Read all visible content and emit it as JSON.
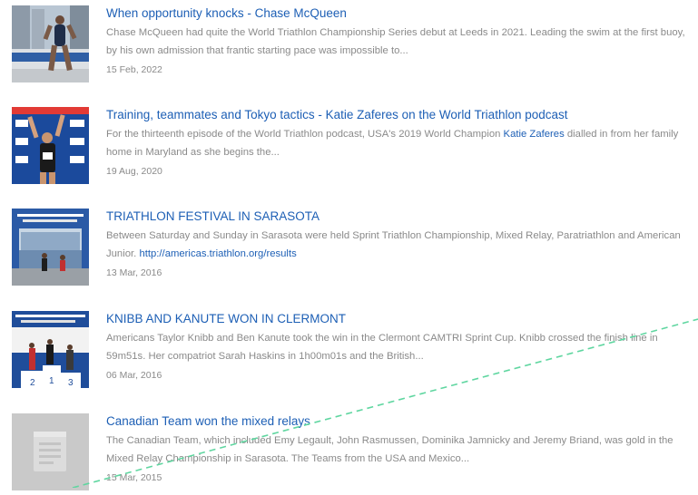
{
  "articles": [
    {
      "title": "When opportunity knocks - Chase McQueen",
      "excerpt": "Chase McQueen had quite the World Triathlon Championship Series debut at Leeds in 2021. Leading the swim at the first buoy, by his own admission that frantic starting pace was impossible to...",
      "date": "15 Feb, 2022",
      "thumbnail": "photo-athlete-running"
    },
    {
      "title": "Training, teammates and Tokyo tactics - Katie Zaferes on the World Triathlon podcast",
      "excerpt_before": "For the thirteenth episode of the World Triathlon podcast, USA's 2019 World Champion ",
      "excerpt_link": "Katie Zaferes",
      "excerpt_after": " dialled in from her family home in Maryland as she begins the...",
      "date": "19 Aug, 2020",
      "thumbnail": "photo-athlete-celebrating"
    },
    {
      "title": "TRIATHLON FESTIVAL IN SARASOTA",
      "excerpt_before": "Between Saturday and Sunday in Sarasota were held Sprint Triathlon Championship, Mixed Relay, Paratriathlon and American Junior. ",
      "excerpt_link": "http://americas.triathlon.org/results",
      "excerpt_after": "",
      "date": "13 Mar, 2016",
      "thumbnail": "photo-finish-line"
    },
    {
      "title": "KNIBB AND KANUTE WON IN CLERMONT",
      "excerpt": "Americans Taylor Knibb and Ben Kanute took the win in the Clermont CAMTRI Sprint Cup. Knibb crossed the finish line in 59m51s. Her compatriot Sarah Haskins in 1h00m01s and the British...",
      "date": "06 Mar, 2016",
      "thumbnail": "photo-podium"
    },
    {
      "title": "Canadian Team won the mixed relays",
      "excerpt": "The Canadian Team, which included Emy Legault, John Rasmussen, Dominika Jamnicky and Jeremy Briand, was gold in the Mixed Relay Championship in Sarasota. The Teams from the USA and Mexico...",
      "date": "15 Mar, 2015",
      "thumbnail": "document-placeholder-icon"
    }
  ],
  "colors": {
    "link": "#1d5fb5",
    "muted_text": "#8a8a8a",
    "overlay_line": "#5fd6a0",
    "placeholder_bg": "#c9c9c9"
  }
}
